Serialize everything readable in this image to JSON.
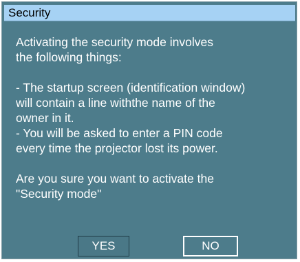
{
  "dialog": {
    "title": "Security",
    "intro_line1": "Activating the security mode involves",
    "intro_line2": "the following things:",
    "point1_line1": "- The startup screen (identification window)",
    "point1_line2": "will contain a line withthe name of the",
    "point1_line3": "owner in it.",
    "point2_line1": "- You will be asked to enter a PIN code",
    "point2_line2": "every time the projector lost its power.",
    "question_line1": "Are you sure you want to activate the",
    "question_line2": "\"Security mode\"",
    "yes_label": "YES",
    "no_label": "NO"
  },
  "colors": {
    "dialog_background": "#4d7c8b",
    "titlebar_background": "#a6d2f4",
    "text": "#ffffff"
  }
}
